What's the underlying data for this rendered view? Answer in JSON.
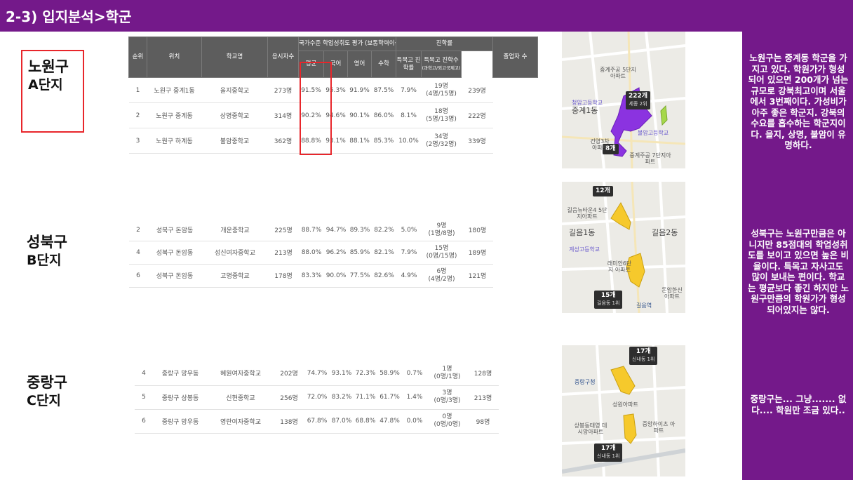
{
  "header": {
    "title": "2-3) 입지분석>학군"
  },
  "regions": [
    {
      "name": "노원구",
      "complex": "A단지"
    },
    {
      "name": "성북구",
      "complex": "B단지"
    },
    {
      "name": "중랑구",
      "complex": "C단지"
    }
  ],
  "table_header": {
    "rank": "순위",
    "location": "위치",
    "school": "학교명",
    "examinees": "응시자수",
    "group_achievement": "국가수준 학업성취도 평가 (보통학력이상)",
    "avg": "평균",
    "korean": "국어",
    "english": "영어",
    "math": "수학",
    "group_advance": "진학률",
    "special_rate": "특목고 진학률",
    "special_count": "특목고 진학수",
    "special_count_sub": "(과학고/외고국제고)",
    "graduates": "졸업자 수"
  },
  "tables": [
    {
      "rows": [
        {
          "rank": "1",
          "location": "노원구 중계1동",
          "school": "을지중학교",
          "examinees": "273명",
          "avg": "91.5%",
          "korean": "95.3%",
          "english": "91.9%",
          "math": "87.5%",
          "special_rate": "7.9%",
          "special_total": "19명",
          "special_detail": "(4명/15명)",
          "graduates": "239명"
        },
        {
          "rank": "2",
          "location": "노원구 중계동",
          "school": "상명중학교",
          "examinees": "314명",
          "avg": "90.2%",
          "korean": "94.6%",
          "english": "90.1%",
          "math": "86.0%",
          "special_rate": "8.1%",
          "special_total": "18명",
          "special_detail": "(5명/13명)",
          "graduates": "222명"
        },
        {
          "rank": "3",
          "location": "노원구 하계동",
          "school": "불암중학교",
          "examinees": "362명",
          "avg": "88.8%",
          "korean": "93.1%",
          "english": "88.1%",
          "math": "85.3%",
          "special_rate": "10.0%",
          "special_total": "34명",
          "special_detail": "(2명/32명)",
          "graduates": "339명"
        }
      ]
    },
    {
      "rows": [
        {
          "rank": "2",
          "location": "성북구 돈암동",
          "school": "개운중학교",
          "examinees": "225명",
          "avg": "88.7%",
          "korean": "94.7%",
          "english": "89.3%",
          "math": "82.2%",
          "special_rate": "5.0%",
          "special_total": "9명",
          "special_detail": "(1명/8명)",
          "graduates": "180명"
        },
        {
          "rank": "4",
          "location": "성북구 돈암동",
          "school": "성신여자중학교",
          "examinees": "213명",
          "avg": "88.0%",
          "korean": "96.2%",
          "english": "85.9%",
          "math": "82.1%",
          "special_rate": "7.9%",
          "special_total": "15명",
          "special_detail": "(0명/15명)",
          "graduates": "189명"
        },
        {
          "rank": "6",
          "location": "성북구 돈암동",
          "school": "고명중학교",
          "examinees": "178명",
          "avg": "83.3%",
          "korean": "90.0%",
          "english": "77.5%",
          "math": "82.6%",
          "special_rate": "4.9%",
          "special_total": "6명",
          "special_detail": "(4명/2명)",
          "graduates": "121명"
        }
      ]
    },
    {
      "rows": [
        {
          "rank": "4",
          "location": "중랑구 망우동",
          "school": "혜원여자중학교",
          "examinees": "202명",
          "avg": "74.7%",
          "korean": "93.1%",
          "english": "72.3%",
          "math": "58.9%",
          "special_rate": "0.7%",
          "special_total": "1명",
          "special_detail": "(0명/1명)",
          "graduates": "128명"
        },
        {
          "rank": "5",
          "location": "중랑구 상봉동",
          "school": "신현중학교",
          "examinees": "256명",
          "avg": "72.0%",
          "korean": "83.2%",
          "english": "71.1%",
          "math": "61.7%",
          "special_rate": "1.4%",
          "special_total": "3명",
          "special_detail": "(0명/3명)",
          "graduates": "213명"
        },
        {
          "rank": "6",
          "location": "중랑구 망우동",
          "school": "영란여자중학교",
          "examinees": "138명",
          "avg": "67.8%",
          "korean": "87.0%",
          "english": "68.8%",
          "math": "47.8%",
          "special_rate": "0.0%",
          "special_total": "0명",
          "special_detail": "(0명/0명)",
          "graduates": "98명"
        }
      ]
    }
  ],
  "maps": [
    {
      "badges": [
        {
          "count": "222개",
          "sub": "세종 2위"
        },
        {
          "count": "8개",
          "sub": ""
        }
      ],
      "labels": {
        "dong": "중계1동",
        "place1": "불암고등학교",
        "place2": "청암고등학교",
        "place3": "중계주공 7단지아파트",
        "place4": "중계주공 5단지아파트",
        "place5": "건영3차 아파트"
      }
    },
    {
      "badges": [
        {
          "count": "12개",
          "sub": ""
        },
        {
          "count": "15개",
          "sub": "길음동 1위"
        }
      ],
      "labels": {
        "dong1": "길음1동",
        "dong2": "길음2동",
        "place1": "길음뉴타운4 5단지아파트",
        "place2": "계성고등학교",
        "place3": "래미안6단지 아파트",
        "place4": "돈암한신 아파트",
        "station": "길음역"
      }
    },
    {
      "badges": [
        {
          "count": "17개",
          "sub": "신내동 1위"
        },
        {
          "count": "17개",
          "sub": "신내동 1위"
        }
      ],
      "labels": {
        "office": "중랑구청",
        "place1": "성원아파트",
        "place2": "상봉동태영 데시앙아파트",
        "place3": "중앙하이츠 아파트"
      }
    }
  ],
  "descriptions": [
    "노원구는 중계동 학군을 가지고 있다. 학원가가 형성되어 있으면 200개가 넘는 규모로 강북최고이며 서울에서 3번째이다. 가성비가 아주 좋은 학군지. 강북의 수요를 흡수하는 학군지이다. 을지, 상명, 불암이 유명하다.",
    "성북구는 노원구만큼은 아니지만 85점대의 학업성취도를 보이고 있으면 높은 비율이다. 특목고 자사고도 많이 보내는 편이다. 학교는 평균보다 좋긴 하지만 노원구만큼의 학원가가 형성되어있지는 않다.",
    "중랑구는... 그냥....... 없다.... 학원만 조금 있다.."
  ],
  "colors": {
    "header_bg": "#74198a",
    "highlight_border": "#e8262b",
    "polygon_purple": "#8b33e0",
    "polygon_yellow": "#f6c92c"
  }
}
